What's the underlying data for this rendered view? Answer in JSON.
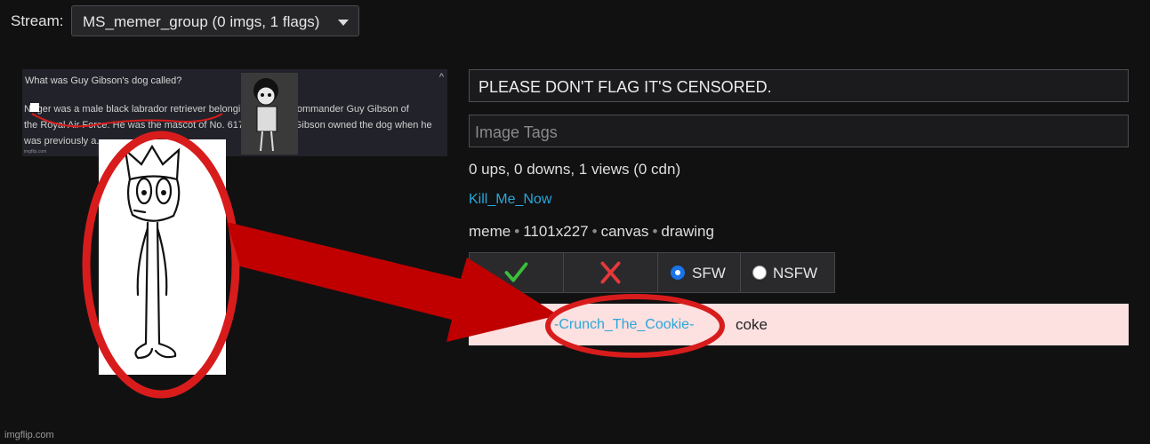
{
  "stream": {
    "label": "Stream:",
    "selected": "MS_memer_group (0 imgs, 1 flags)"
  },
  "preview": {
    "question": "What was Guy Gibson's dog called?",
    "line1": "N■ger was a male black labrador retriever belonging to Wing Commander Guy Gibson of",
    "line2": "the Royal Air Force. He was the mascot of No. 617 Squadron. Gibson owned the dog when he",
    "line3": "was previously a...",
    "credit": "imgflip.com"
  },
  "form": {
    "title_value": "PLEASE DON'T FLAG IT'S CENSORED.",
    "tags_placeholder": "Image Tags",
    "stats": "0 ups, 0 downs, 1 views (0 cdn)",
    "author": "Kill_Me_Now",
    "meta": [
      "meme",
      "1101x227",
      "canvas",
      "drawing"
    ]
  },
  "moderation": {
    "sfw_label": "SFW",
    "nsfw_label": "NSFW",
    "sfw_selected": true,
    "approve_icon": "check-icon",
    "reject_icon": "x-icon"
  },
  "flag": {
    "user": "-Crunch_The_Cookie-",
    "reason": "coke"
  },
  "watermark": "imgflip.com",
  "colors": {
    "background": "#111112",
    "accent_blue": "#2aa7d9",
    "check_green": "#3bbf3b",
    "x_red": "#e5383b",
    "flag_row_bg": "#fde0e0",
    "annotation_red": "#d81c1c"
  }
}
